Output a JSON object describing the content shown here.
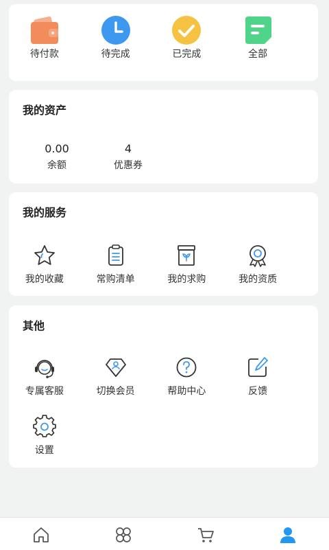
{
  "orders": {
    "items": [
      {
        "label": "待付款",
        "icon": "wallet-icon",
        "color": "#f0875a"
      },
      {
        "label": "待完成",
        "icon": "clock-icon",
        "color": "#3d98f0"
      },
      {
        "label": "已完成",
        "icon": "check-icon",
        "color": "#f5c242"
      },
      {
        "label": "全部",
        "icon": "list-doc-icon",
        "color": "#4fd48a"
      }
    ]
  },
  "assets": {
    "title": "我的资产",
    "balance": {
      "value": "0.00",
      "label": "余额"
    },
    "coupons": {
      "value": "4",
      "label": "优惠券"
    }
  },
  "services": {
    "title": "我的服务",
    "items": [
      {
        "label": "我的收藏",
        "icon": "star-icon"
      },
      {
        "label": "常购清单",
        "icon": "clipboard-icon"
      },
      {
        "label": "我的求购",
        "icon": "sprout-box-icon"
      },
      {
        "label": "我的资质",
        "icon": "medal-icon"
      }
    ]
  },
  "others": {
    "title": "其他",
    "items": [
      {
        "label": "专属客服",
        "icon": "headset-icon"
      },
      {
        "label": "切换会员",
        "icon": "diamond-user-icon"
      },
      {
        "label": "帮助中心",
        "icon": "question-icon"
      },
      {
        "label": "反馈",
        "icon": "edit-icon"
      },
      {
        "label": "设置",
        "icon": "gear-icon"
      }
    ]
  },
  "tabbar": {
    "active_color": "#2196f3",
    "items": [
      {
        "icon": "home-icon"
      },
      {
        "icon": "category-icon"
      },
      {
        "icon": "cart-icon"
      },
      {
        "icon": "user-icon"
      }
    ]
  }
}
